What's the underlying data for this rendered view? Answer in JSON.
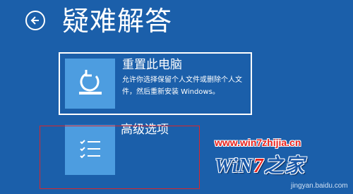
{
  "header": {
    "title": "疑难解答"
  },
  "options": [
    {
      "title": "重置此电脑",
      "description": "允许你选择保留个人文件或删除个人文件，然后重新安装 Windows。",
      "icon": "reset-pc-icon"
    },
    {
      "title": "高级选项",
      "icon": "checklist-icon"
    }
  ],
  "watermark": {
    "url": "www.win7zhijia.cn",
    "logo_prefix": "WiN",
    "logo_seven": "7",
    "logo_suffix": "之家",
    "site": "jingyan.baidu.com"
  },
  "colors": {
    "background": "#1b5faa",
    "tile": "#4d9de0",
    "highlight": "#d9262c"
  }
}
